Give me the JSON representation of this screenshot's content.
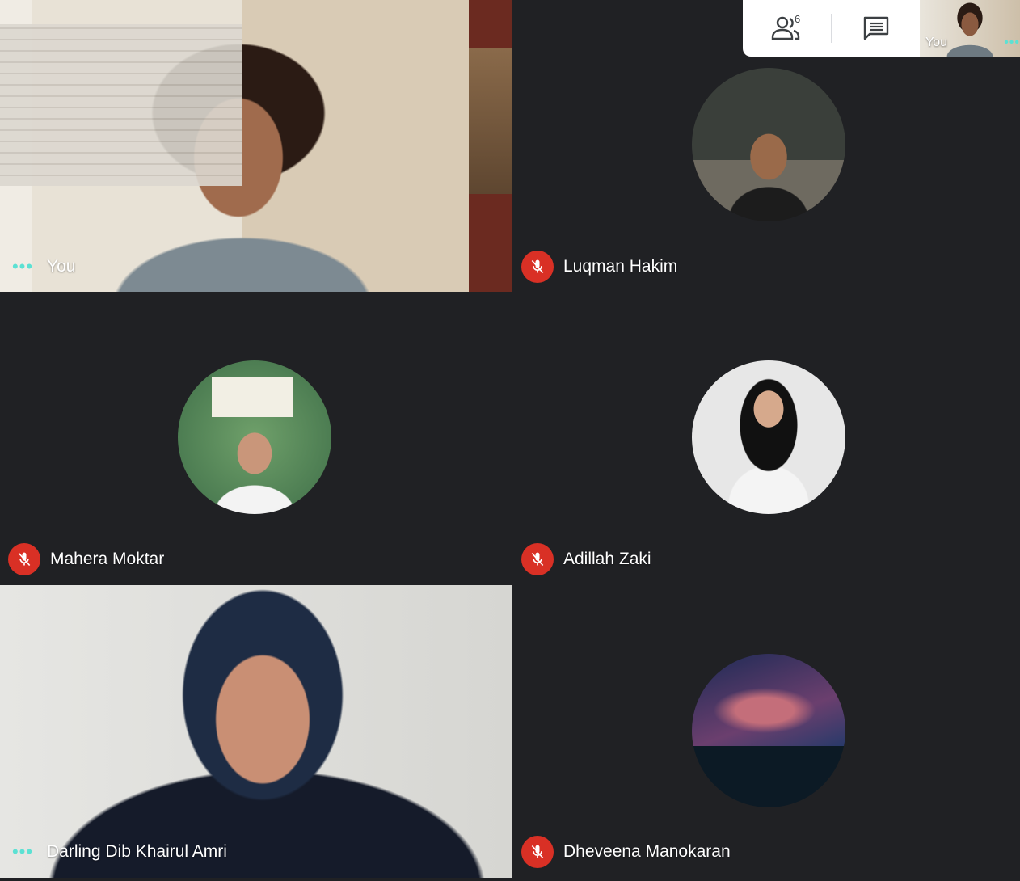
{
  "participants_count": "6",
  "self_view": {
    "label": "You"
  },
  "tiles": [
    {
      "name": "You",
      "muted": false
    },
    {
      "name": "Luqman Hakim",
      "muted": true
    },
    {
      "name": "Mahera Moktar",
      "muted": true
    },
    {
      "name": "Adillah Zaki",
      "muted": true
    },
    {
      "name": "Darling Dib Khairul Amri",
      "muted": false
    },
    {
      "name": "Dheveena Manokaran",
      "muted": true
    }
  ],
  "colors": {
    "background": "#202124",
    "muted_badge": "#d93025",
    "speaking_dots": "#5ce1d3"
  }
}
